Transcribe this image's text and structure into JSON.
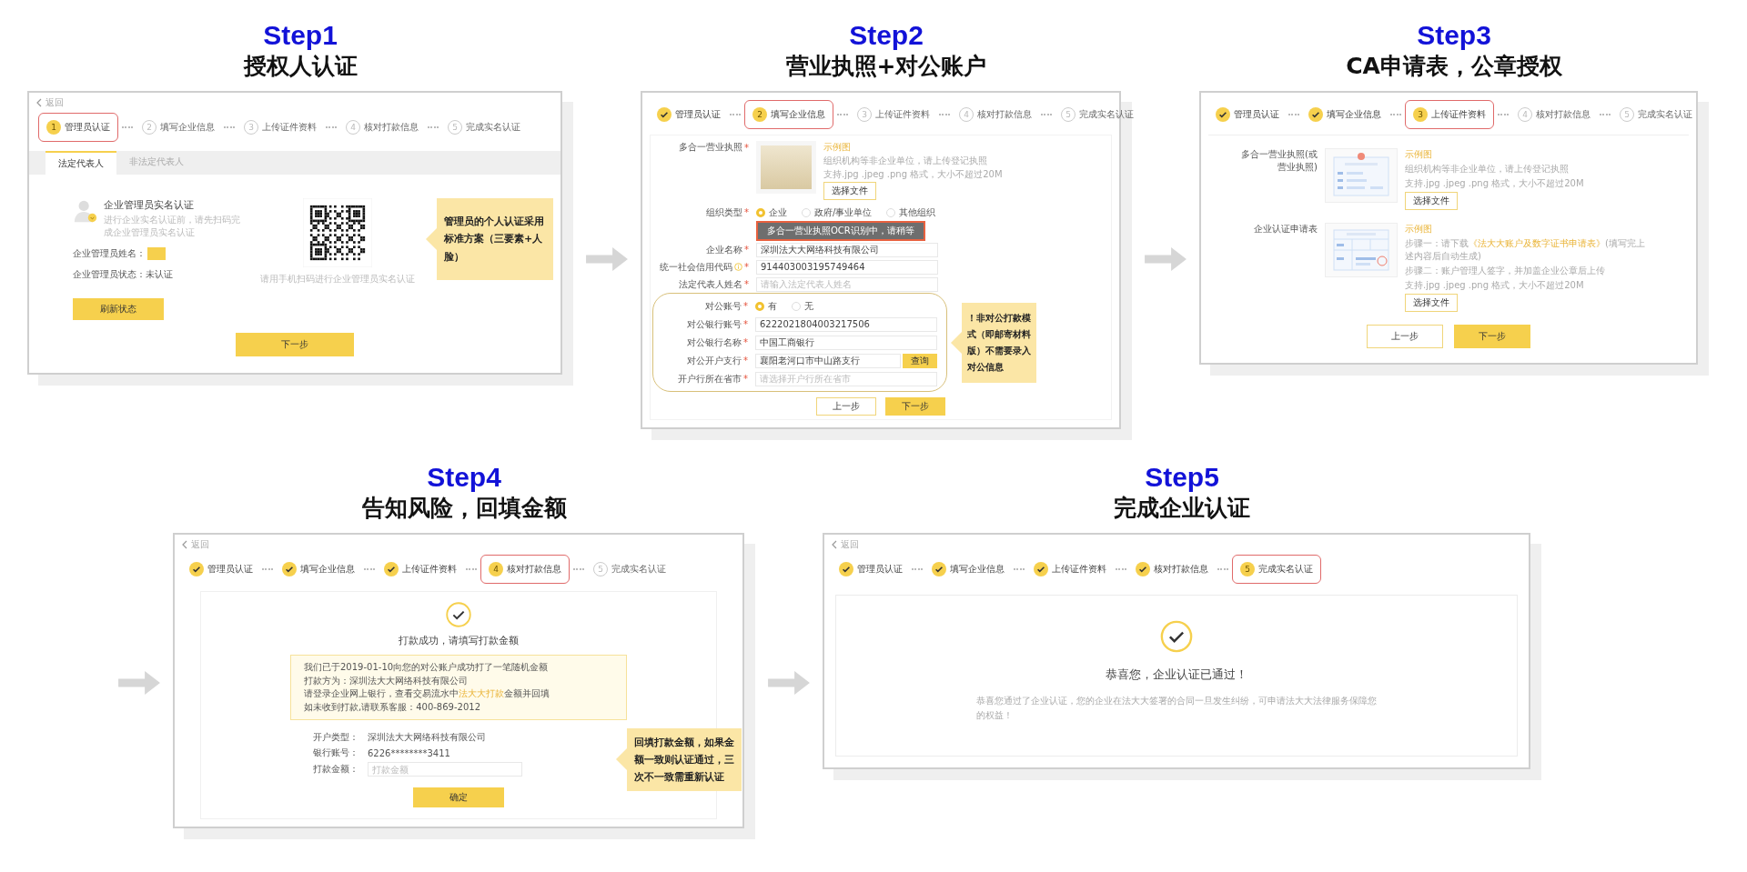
{
  "flow": [
    {
      "kind": "admin",
      "step": "Step1",
      "title": "授权人认证",
      "back": "返回",
      "steps": [
        {
          "number": "1",
          "label": "管理员认证",
          "done": false,
          "current": true
        },
        {
          "number": "2",
          "label": "填写企业信息",
          "done": false,
          "current": false
        },
        {
          "number": "3",
          "label": "上传证件资料",
          "done": false,
          "current": false
        },
        {
          "number": "4",
          "label": "核对打款信息",
          "done": false,
          "current": false
        },
        {
          "number": "5",
          "label": "完成实名认证",
          "done": false,
          "current": false
        }
      ],
      "tabs": [
        {
          "label": "法定代表人",
          "selected": true
        },
        {
          "label": "非法定代表人",
          "selected": false
        }
      ],
      "heading": "企业管理员实名认证",
      "hint": "进行企业实名认证前，请先扫码完成企业管理员实名认证",
      "name_label": "企业管理员姓名：",
      "status_text": "企业管理员状态：未认证",
      "refresh_button": "刷新状态",
      "qr_caption": "请用手机扫码进行企业管理员实名认证",
      "callout": "管理员的个人认证采用标准方案（三要素+人脸）",
      "next_button": "下一步"
    },
    {
      "kind": "company",
      "step": "Step2",
      "title": "营业执照+对公账户",
      "steps": [
        {
          "label": "管理员认证",
          "done": true,
          "current": false
        },
        {
          "number": "2",
          "label": "填写企业信息",
          "done": false,
          "current": true
        },
        {
          "number": "3",
          "label": "上传证件资料",
          "done": false,
          "current": false
        },
        {
          "number": "4",
          "label": "核对打款信息",
          "done": false,
          "current": false
        },
        {
          "number": "5",
          "label": "完成实名认证",
          "done": false,
          "current": false
        }
      ],
      "license": {
        "label": "多合一营业执照",
        "mark": "*",
        "sample": "示例图",
        "notes": [
          "组织机构等非企业单位，请上传登记执照",
          "支持.jpg .jpeg .png 格式，大小不超过20M"
        ],
        "button": "选择文件"
      },
      "org_type": {
        "label": "组织类型",
        "mark": "*",
        "options": [
          {
            "label": "企业",
            "selected": true
          },
          {
            "label": "政府/事业单位",
            "selected": false
          },
          {
            "label": "其他组织",
            "selected": false
          }
        ]
      },
      "toast": "多合一营业执照OCR识别中，请稍等",
      "fields": [
        {
          "label": "企业名称",
          "mark": "*",
          "value": "深圳法大大网络科技有限公司"
        },
        {
          "label": "统一社会信用代码",
          "mark": "*",
          "value": "914403003195749464",
          "info": true
        },
        {
          "label": "法定代表人姓名",
          "mark": "*",
          "placeholder": "请输入法定代表人姓名"
        }
      ],
      "account": {
        "label": "对公账号",
        "mark": "*",
        "options": [
          {
            "label": "有",
            "selected": true
          },
          {
            "label": "无",
            "selected": false
          }
        ]
      },
      "bank_fields": [
        {
          "label": "对公银行账号",
          "mark": "*",
          "value": "6222021804003217506"
        },
        {
          "label": "对公银行名称",
          "mark": "*",
          "value": "中国工商银行"
        },
        {
          "label": "对公开户支行",
          "mark": "*",
          "value": "襄阳老河口市中山路支行",
          "action": "查询"
        },
        {
          "label": "开户行所在省市",
          "mark": "*",
          "placeholder": "请选择开户行所在省市"
        }
      ],
      "callout": "！非对公打款模式（即邮寄材料版）不需要录入对公信息",
      "prev_button": "上一步",
      "next_button": "下一步"
    },
    {
      "kind": "documents",
      "step": "Step3",
      "title": "CA申请表，公章授权",
      "steps": [
        {
          "label": "管理员认证",
          "done": true,
          "current": false
        },
        {
          "label": "填写企业信息",
          "done": true,
          "current": false
        },
        {
          "number": "3",
          "label": "上传证件资料",
          "done": false,
          "current": true
        },
        {
          "number": "4",
          "label": "核对打款信息",
          "done": false,
          "current": false
        },
        {
          "number": "5",
          "label": "完成实名认证",
          "done": false,
          "current": false
        }
      ],
      "uploads": [
        {
          "label": "多合一营业执照(或营业执照)",
          "kind": "license",
          "sample": "示例图",
          "notes": [
            {
              "parts": [
                {
                  "text": "组织机构等非企业单位，请上传登记执照",
                  "kind": "plain"
                }
              ]
            },
            {
              "parts": [
                {
                  "text": "支持.jpg .jpeg .png 格式，大小不超过20M",
                  "kind": "plain"
                }
              ]
            }
          ],
          "button": "选择文件"
        },
        {
          "label": "企业认证申请表",
          "kind": "form",
          "sample": "示例图",
          "notes": [
            {
              "parts": [
                {
                  "text": "步骤一：请下载",
                  "kind": "plain"
                },
                {
                  "text": "《法大大账户及数字证书申请表》",
                  "kind": "link"
                },
                {
                  "text": "(填写完上述内容后自动生成)",
                  "kind": "plain"
                }
              ]
            },
            {
              "parts": [
                {
                  "text": "步骤二：账户管理人签字，并加盖企业公章后上传",
                  "kind": "plain"
                }
              ]
            },
            {
              "parts": [
                {
                  "text": "支持.jpg .jpeg .png 格式，大小不超过20M",
                  "kind": "plain"
                }
              ]
            }
          ],
          "button": "选择文件"
        }
      ],
      "prev_button": "上一步",
      "next_button": "下一步"
    },
    {
      "kind": "payment",
      "step": "Step4",
      "title": "告知风险，回填金额",
      "back": "返回",
      "steps": [
        {
          "label": "管理员认证",
          "done": true,
          "current": false
        },
        {
          "label": "填写企业信息",
          "done": true,
          "current": false
        },
        {
          "label": "上传证件资料",
          "done": true,
          "current": false
        },
        {
          "number": "4",
          "label": "核对打款信息",
          "done": false,
          "current": true
        },
        {
          "number": "5",
          "label": "完成实名认证",
          "done": false,
          "current": false
        }
      ],
      "heading": "打款成功，请填写打款金额",
      "notice": [
        {
          "parts": [
            {
              "text": "我们已于2019-01-10向您的对公账户成功打了一笔随机金额",
              "kind": "plain"
            }
          ]
        },
        {
          "parts": [
            {
              "text": "打款方为：深圳法大大网络科技有限公司",
              "kind": "plain"
            }
          ]
        },
        {
          "parts": [
            {
              "text": "请登录企业网上银行，查看交易流水中",
              "kind": "plain"
            },
            {
              "text": "法大大打款",
              "kind": "link"
            },
            {
              "text": "金额并回填",
              "kind": "plain"
            }
          ]
        },
        {
          "parts": [
            {
              "text": "如未收到打款,请联系客服：400-869-2012",
              "kind": "plain"
            }
          ]
        }
      ],
      "rows": [
        {
          "label": "开户类型：",
          "value": "深圳法大大网络科技有限公司"
        },
        {
          "label": "银行账号：",
          "value": "6226********3411"
        },
        {
          "label": "打款金额：",
          "placeholder": "打款金额"
        }
      ],
      "confirm_button": "确定",
      "callout": "回填打款金额，如果金额一致则认证通过，三次不一致需重新认证"
    },
    {
      "kind": "complete",
      "step": "Step5",
      "title": "完成企业认证",
      "back": "返回",
      "steps": [
        {
          "label": "管理员认证",
          "done": true,
          "current": false
        },
        {
          "label": "填写企业信息",
          "done": true,
          "current": false
        },
        {
          "label": "上传证件资料",
          "done": true,
          "current": false
        },
        {
          "label": "核对打款信息",
          "done": true,
          "current": false
        },
        {
          "number": "5",
          "label": "完成实名认证",
          "done": false,
          "current": true
        }
      ],
      "heading": "恭喜您，企业认证已通过！",
      "message": "恭喜您通过了企业认证，您的企业在法大大签署的合同一旦发生纠纷，可申请法大大法律服务保障您的权益！"
    }
  ]
}
